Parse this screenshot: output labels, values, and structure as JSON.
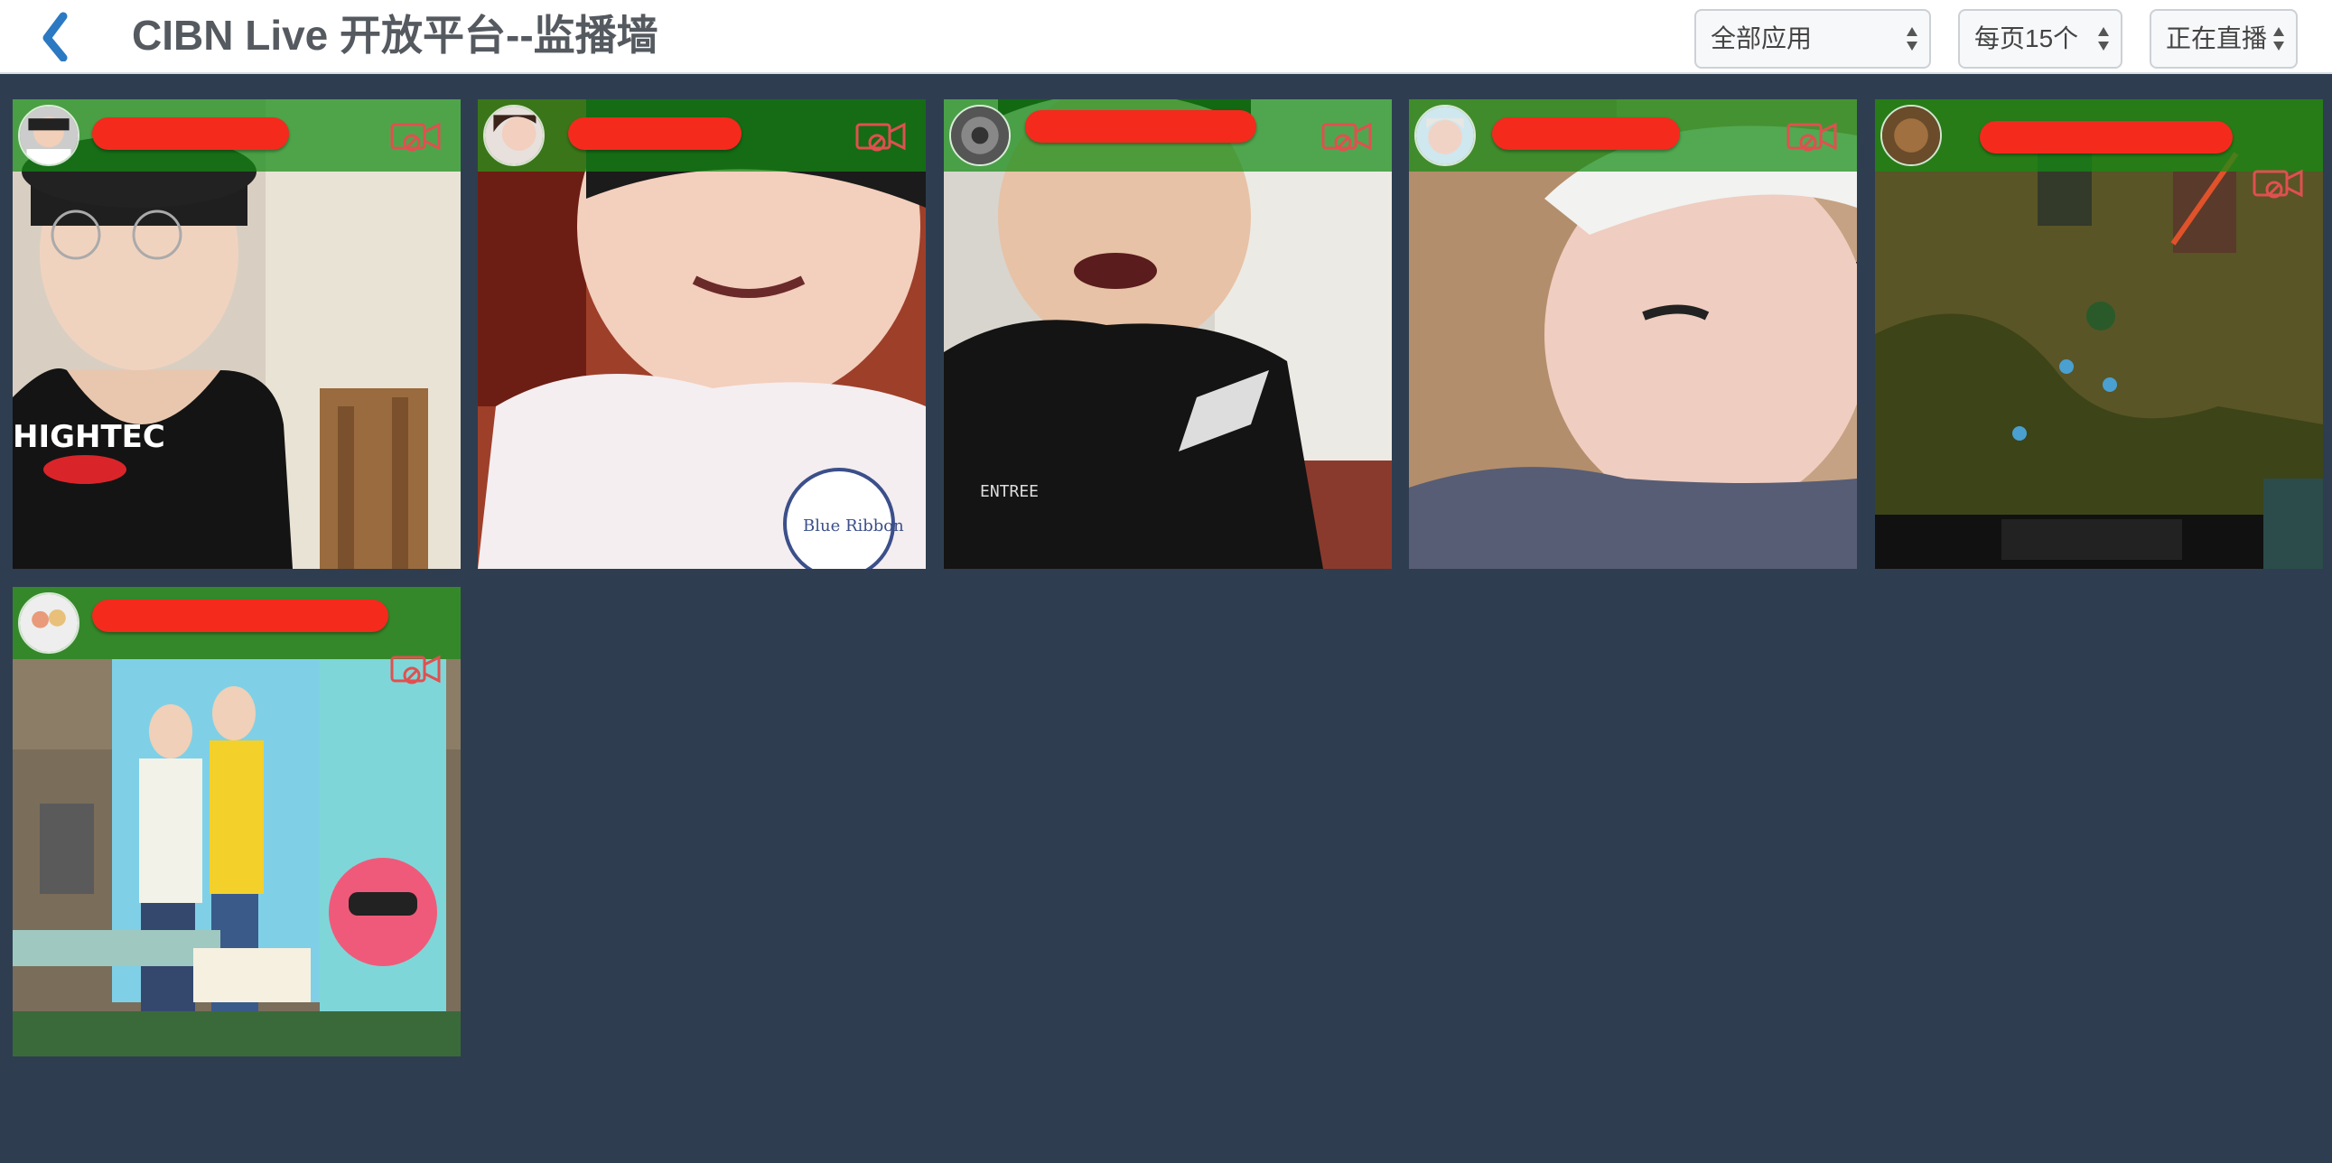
{
  "header": {
    "title": "CIBN Live 开放平台--监播墙"
  },
  "filters": {
    "app": "全部应用",
    "page_size": "每页15个",
    "status": "正在直播"
  },
  "colors": {
    "background": "#2e3e50",
    "tile_header": "#148c14",
    "redaction": "#f42a1d",
    "back_arrow": "#2b79c2"
  },
  "streams": [
    {
      "thumb": "person-basketball-jersey"
    },
    {
      "thumb": "person-white-tshirt"
    },
    {
      "thumb": "person-black-tshirt"
    },
    {
      "thumb": "person-bleached-hair"
    },
    {
      "thumb": "game-moba-screen"
    },
    {
      "thumb": "outdoor-promo-event"
    }
  ]
}
